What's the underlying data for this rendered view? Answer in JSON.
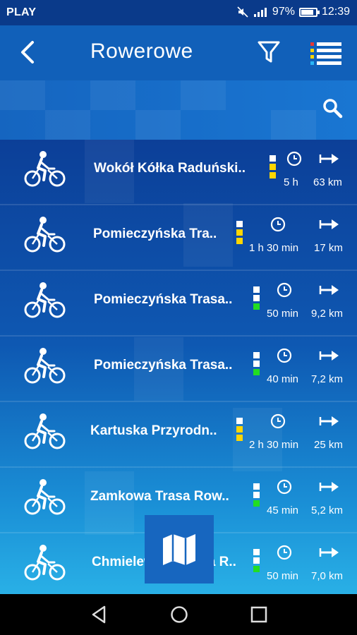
{
  "status": {
    "carrier": "PLAY",
    "battery": "97%",
    "battery_level": 0.97,
    "time": "12:39"
  },
  "appbar": {
    "title": "Rowerowe"
  },
  "icons": {
    "back": "back-arrow-icon",
    "filter": "filter-icon",
    "menu": "list-menu-icon",
    "search": "search-icon",
    "map": "map-icon"
  },
  "colors": {
    "header": "#1160b9",
    "list_top": "#0c3f98",
    "list_bottom": "#29b0e6",
    "difficulty_easy": "#22dd22",
    "difficulty_medium": "#ffd600",
    "difficulty_empty": "#ffffff"
  },
  "routes": [
    {
      "name": "Wokół Kółka Raduński..",
      "time": "5 h",
      "distance": "63 km",
      "difficulty": [
        "empty",
        "medium",
        "medium"
      ]
    },
    {
      "name": "Pomieczyńska Tra..",
      "time": "1 h 30 min",
      "distance": "17 km",
      "difficulty": [
        "empty",
        "medium",
        "medium"
      ]
    },
    {
      "name": "Pomieczyńska Trasa..",
      "time": "50 min",
      "distance": "9,2 km",
      "difficulty": [
        "empty",
        "empty",
        "easy"
      ]
    },
    {
      "name": "Pomieczyńska Trasa..",
      "time": "40 min",
      "distance": "7,2 km",
      "difficulty": [
        "empty",
        "empty",
        "easy"
      ]
    },
    {
      "name": "Kartuska Przyrodn..",
      "time": "2 h 30 min",
      "distance": "25 km",
      "difficulty": [
        "empty",
        "medium",
        "medium"
      ]
    },
    {
      "name": "Zamkowa Trasa Row..",
      "time": "45 min",
      "distance": "5,2 km",
      "difficulty": [
        "empty",
        "empty",
        "easy"
      ]
    },
    {
      "name": "Chmielewska Trasa R..",
      "time": "50 min",
      "distance": "7,0 km",
      "difficulty": [
        "empty",
        "empty",
        "easy"
      ]
    }
  ]
}
